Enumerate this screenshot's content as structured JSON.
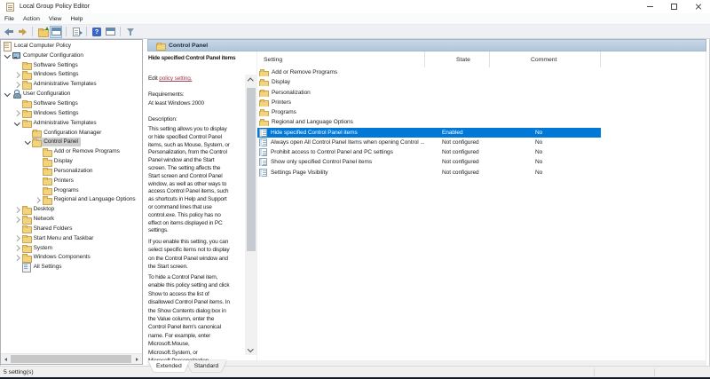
{
  "window": {
    "title": "Local Group Policy Editor"
  },
  "menu": {
    "items": [
      "File",
      "Action",
      "View",
      "Help"
    ]
  },
  "toolbar": {
    "icons": [
      "back-arrow",
      "forward-arrow",
      "up-one-level-folder",
      "show-console-tree",
      "export-list",
      "help",
      "show-window",
      "filter"
    ]
  },
  "tree": {
    "items": [
      {
        "label": "Local Computer Policy",
        "depth": 0,
        "chev": "none",
        "icon": "scroll",
        "selected": false
      },
      {
        "label": "Computer Configuration",
        "depth": 1,
        "chev": "open",
        "icon": "computer",
        "selected": false
      },
      {
        "label": "Software Settings",
        "depth": 2,
        "chev": "none",
        "icon": "folder",
        "selected": false
      },
      {
        "label": "Windows Settings",
        "depth": 2,
        "chev": "closed",
        "icon": "folder",
        "selected": false
      },
      {
        "label": "Administrative Templates",
        "depth": 2,
        "chev": "closed",
        "icon": "folder",
        "selected": false
      },
      {
        "label": "User Configuration",
        "depth": 1,
        "chev": "open",
        "icon": "user",
        "selected": false
      },
      {
        "label": "Software Settings",
        "depth": 2,
        "chev": "none",
        "icon": "folder",
        "selected": false
      },
      {
        "label": "Windows Settings",
        "depth": 2,
        "chev": "closed",
        "icon": "folder",
        "selected": false
      },
      {
        "label": "Administrative Templates",
        "depth": 2,
        "chev": "open",
        "icon": "folder",
        "selected": false
      },
      {
        "label": "Configuration Manager",
        "depth": 3,
        "chev": "none",
        "icon": "folder",
        "selected": false
      },
      {
        "label": "Control Panel",
        "depth": 3,
        "chev": "open",
        "icon": "folder",
        "selected": true
      },
      {
        "label": "Add or Remove Programs",
        "depth": 4,
        "chev": "none",
        "icon": "folder",
        "selected": false
      },
      {
        "label": "Display",
        "depth": 4,
        "chev": "none",
        "icon": "folder",
        "selected": false
      },
      {
        "label": "Personalization",
        "depth": 4,
        "chev": "none",
        "icon": "folder",
        "selected": false
      },
      {
        "label": "Printers",
        "depth": 4,
        "chev": "none",
        "icon": "folder",
        "selected": false
      },
      {
        "label": "Programs",
        "depth": 4,
        "chev": "none",
        "icon": "folder",
        "selected": false
      },
      {
        "label": "Regional and Language Options",
        "depth": 4,
        "chev": "closed",
        "icon": "folder",
        "selected": false
      },
      {
        "label": "Desktop",
        "depth": 2,
        "chev": "closed",
        "icon": "folder",
        "selected": false
      },
      {
        "label": "Network",
        "depth": 2,
        "chev": "closed",
        "icon": "folder",
        "selected": false
      },
      {
        "label": "Shared Folders",
        "depth": 2,
        "chev": "none",
        "icon": "folder",
        "selected": false
      },
      {
        "label": "Start Menu and Taskbar",
        "depth": 2,
        "chev": "closed",
        "icon": "folder",
        "selected": false
      },
      {
        "label": "System",
        "depth": 2,
        "chev": "closed",
        "icon": "folder",
        "selected": false
      },
      {
        "label": "Windows Components",
        "depth": 2,
        "chev": "closed",
        "icon": "folder",
        "selected": false
      },
      {
        "label": "All Settings",
        "depth": 2,
        "chev": "none",
        "icon": "settings",
        "selected": false
      }
    ]
  },
  "extended_pane": {
    "header": "Control Panel",
    "title": "Hide specified Control Panel items",
    "edit_prefix": "Edit ",
    "edit_link": "policy setting.",
    "requirements_label": "Requirements:",
    "requirements": "At least Windows 2000",
    "description_label": "Description:",
    "paragraphs": [
      [
        "This setting allows you to display",
        "or hide specified Control Panel",
        "items, such as Mouse, System, or",
        "Personalization, from the Control",
        "Panel window and the Start",
        "screen. The setting affects the",
        "Start screen and Control Panel",
        "window, as well as other ways to",
        "access Control Panel items, such",
        "as shortcuts in Help and Support",
        "or command lines that use",
        "control.exe. This policy has no",
        "effect on items displayed in PC",
        "settings."
      ],
      [
        "If you enable this setting, you can",
        "select specific items not to display",
        "on the Control Panel window and",
        "the Start screen."
      ],
      [
        "To hide a Control Panel item,",
        "enable this policy setting and click",
        "Show to access the list of",
        "disallowed Control Panel items. In",
        "the Show Contents dialog box in",
        "the Value column, enter the",
        "Control Panel item's canonical",
        "name. For example, enter",
        "Microsoft.Mouse,",
        "Microsoft.System, or",
        "Microsoft.Personalization."
      ]
    ]
  },
  "list": {
    "columns": [
      "Setting",
      "State",
      "Comment"
    ],
    "rows": [
      {
        "icon": "folder",
        "setting": "Add or Remove Programs",
        "state": "",
        "comment": "",
        "selected": false
      },
      {
        "icon": "folder",
        "setting": "Display",
        "state": "",
        "comment": "",
        "selected": false
      },
      {
        "icon": "folder",
        "setting": "Personalization",
        "state": "",
        "comment": "",
        "selected": false
      },
      {
        "icon": "folder",
        "setting": "Printers",
        "state": "",
        "comment": "",
        "selected": false
      },
      {
        "icon": "folder",
        "setting": "Programs",
        "state": "",
        "comment": "",
        "selected": false
      },
      {
        "icon": "folder",
        "setting": "Regional and Language Options",
        "state": "",
        "comment": "",
        "selected": false
      },
      {
        "icon": "policy",
        "setting": "Hide specified Control Panel items",
        "state": "Enabled",
        "comment": "No",
        "selected": true
      },
      {
        "icon": "policy",
        "setting": "Always open All Control Panel Items when opening Control ...",
        "state": "Not configured",
        "comment": "No",
        "selected": false
      },
      {
        "icon": "policy",
        "setting": "Prohibit access to Control Panel and PC settings",
        "state": "Not configured",
        "comment": "No",
        "selected": false
      },
      {
        "icon": "policy",
        "setting": "Show only specified Control Panel items",
        "state": "Not configured",
        "comment": "No",
        "selected": false
      },
      {
        "icon": "policy",
        "setting": "Settings Page Visibility",
        "state": "Not configured",
        "comment": "No",
        "selected": false
      }
    ]
  },
  "tabs": {
    "items": [
      "Extended",
      "Standard"
    ],
    "active": "Extended"
  },
  "status": {
    "text": "5 setting(s)"
  },
  "colors": {
    "accent": "#0078d7",
    "band": "#b9cde1",
    "link": "#a04355",
    "tree_selected": "#cecece"
  }
}
